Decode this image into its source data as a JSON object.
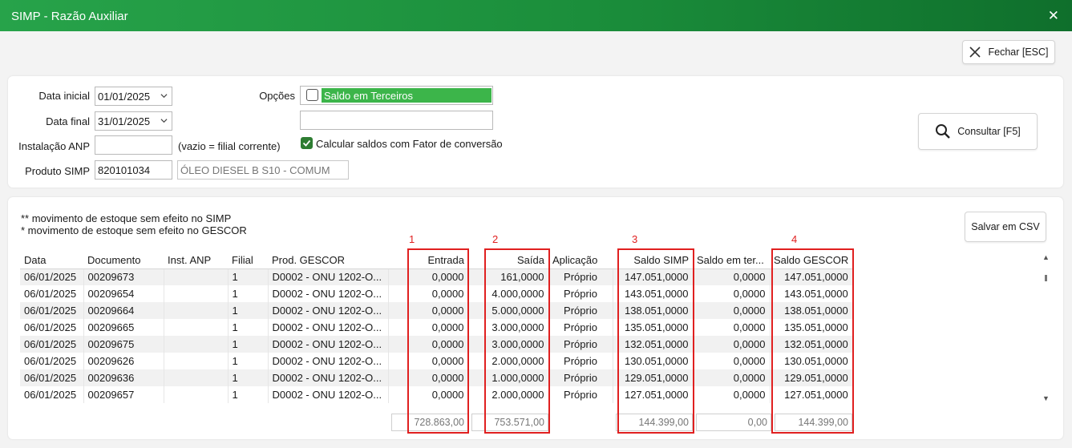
{
  "window": {
    "title": "SIMP - Razão Auxiliar",
    "close_glyph": "✕"
  },
  "toolbar": {
    "close_label": "Fechar [ESC]"
  },
  "filters": {
    "data_inicial_label": "Data inicial",
    "data_inicial_value": "01/01/2025",
    "data_final_label": "Data final",
    "data_final_value": "31/01/2025",
    "instalacao_label": "Instalação ANP",
    "instalacao_value": "",
    "instalacao_hint": "(vazio = filial corrente)",
    "produto_label": "Produto SIMP",
    "produto_code": "820101034",
    "produto_desc": "ÓLEO DIESEL B S10 - COMUM",
    "opcoes_label": "Opções",
    "opcao_item": "Saldo em Terceiros",
    "opcao_checked": false,
    "calc_label": "Calcular saldos com Fator de conversão",
    "calc_checked": true,
    "consultar_label": "Consultar [F5]"
  },
  "notes": {
    "line1": "** movimento de estoque sem efeito no SIMP",
    "line2": "* movimento de estoque sem efeito no GESCOR"
  },
  "save_csv_label": "Salvar em CSV",
  "annotations": [
    "1",
    "2",
    "3",
    "4"
  ],
  "table": {
    "columns": [
      "Data",
      "Documento",
      "Inst. ANP",
      "Filial",
      "Prod. GESCOR",
      "Entrada",
      "Saída",
      "Aplicação",
      "Saldo SIMP",
      "Saldo em ter...",
      "Saldo GESCOR"
    ],
    "rows": [
      [
        "06/01/2025",
        "00209673",
        "",
        "1",
        "D0002 - ONU 1202-O...",
        "0,0000",
        "161,0000",
        "Próprio",
        "147.051,0000",
        "0,0000",
        "147.051,0000"
      ],
      [
        "06/01/2025",
        "00209654",
        "",
        "1",
        "D0002 - ONU 1202-O...",
        "0,0000",
        "4.000,0000",
        "Próprio",
        "143.051,0000",
        "0,0000",
        "143.051,0000"
      ],
      [
        "06/01/2025",
        "00209664",
        "",
        "1",
        "D0002 - ONU 1202-O...",
        "0,0000",
        "5.000,0000",
        "Próprio",
        "138.051,0000",
        "0,0000",
        "138.051,0000"
      ],
      [
        "06/01/2025",
        "00209665",
        "",
        "1",
        "D0002 - ONU 1202-O...",
        "0,0000",
        "3.000,0000",
        "Próprio",
        "135.051,0000",
        "0,0000",
        "135.051,0000"
      ],
      [
        "06/01/2025",
        "00209675",
        "",
        "1",
        "D0002 - ONU 1202-O...",
        "0,0000",
        "3.000,0000",
        "Próprio",
        "132.051,0000",
        "0,0000",
        "132.051,0000"
      ],
      [
        "06/01/2025",
        "00209626",
        "",
        "1",
        "D0002 - ONU 1202-O...",
        "0,0000",
        "2.000,0000",
        "Próprio",
        "130.051,0000",
        "0,0000",
        "130.051,0000"
      ],
      [
        "06/01/2025",
        "00209636",
        "",
        "1",
        "D0002 - ONU 1202-O...",
        "0,0000",
        "1.000,0000",
        "Próprio",
        "129.051,0000",
        "0,0000",
        "129.051,0000"
      ],
      [
        "06/01/2025",
        "00209657",
        "",
        "1",
        "D0002 - ONU 1202-O...",
        "0,0000",
        "2.000,0000",
        "Próprio",
        "127.051,0000",
        "0,0000",
        "127.051,0000"
      ]
    ],
    "totals": {
      "entrada": "728.863,00",
      "saida": "753.571,00",
      "saldo_simp": "144.399,00",
      "saldo_terceiros": "0,00",
      "saldo_gescor": "144.399,00"
    }
  },
  "colors": {
    "title_green": "#1b8e3b",
    "highlight_green": "#3cb54a",
    "annotation_red": "#e02020"
  }
}
